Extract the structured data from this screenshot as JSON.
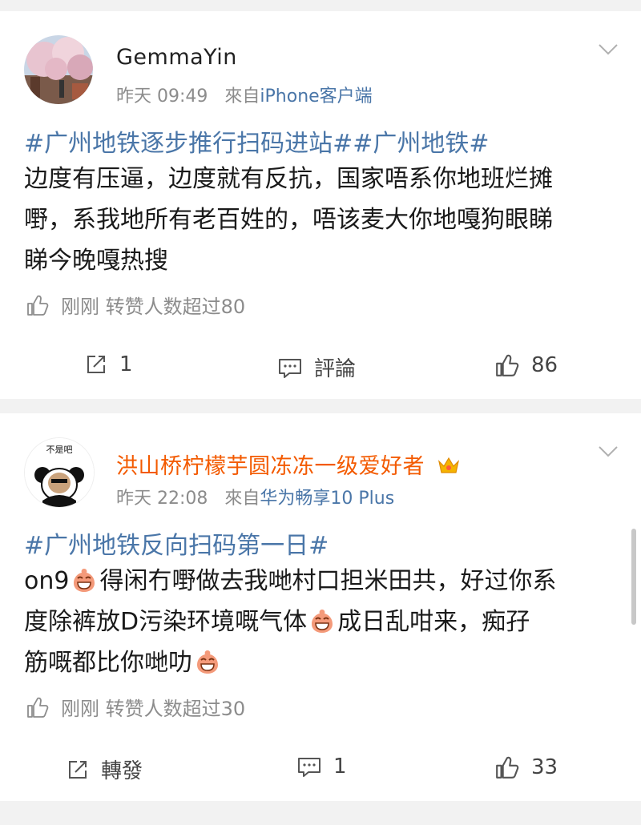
{
  "posts": [
    {
      "username": "GemmaYin",
      "time": "昨天 09:49",
      "source_prefix": "來自",
      "source": "iPhone客户端",
      "topic": "#广州地铁逐步推行扫码进站##广州地铁#",
      "body_lines": [
        "边度有压逼，边度就有反抗，国家唔系你地班烂摊",
        "嘢，系我地所有老百姓的，唔该麦大你地嘎狗眼睇",
        "睇今晚嘎热搜"
      ],
      "likes_line": "刚刚 转赞人数超过80",
      "repost_label": "1",
      "comment_label": "評論",
      "like_count": "86"
    },
    {
      "username": "洪山桥柠檬芋圆冻冻一级爱好者",
      "avatar_caption": "不是吧",
      "time": "昨天 22:08",
      "source_prefix": "來自",
      "source": "华为畅享10 Plus",
      "topic": "#广州地铁反向扫码第一日#",
      "line1a": "on9",
      "line1b": "得闲冇嘢做去我哋村口担米田共，好过你系",
      "line2a": "度除裤放D污染环境嘅气体",
      "line2b": "成日乱咁来，痴孖",
      "line3a": "筋嘅都比你哋叻",
      "likes_line": "刚刚 转赞人数超过30",
      "repost_label": "轉發",
      "comment_label": "1",
      "like_count": "33"
    }
  ],
  "icons": {
    "chevron": "chevron-down-icon",
    "repost": "repost-icon",
    "comment": "comment-icon",
    "like": "thumbs-up-icon",
    "emoji": "grinning-face-emoji",
    "crown": "crown-badge-icon"
  },
  "colors": {
    "link_blue": "#4a76a8",
    "vip_name": "#f35a00",
    "meta_gray": "#8c8c8c"
  }
}
